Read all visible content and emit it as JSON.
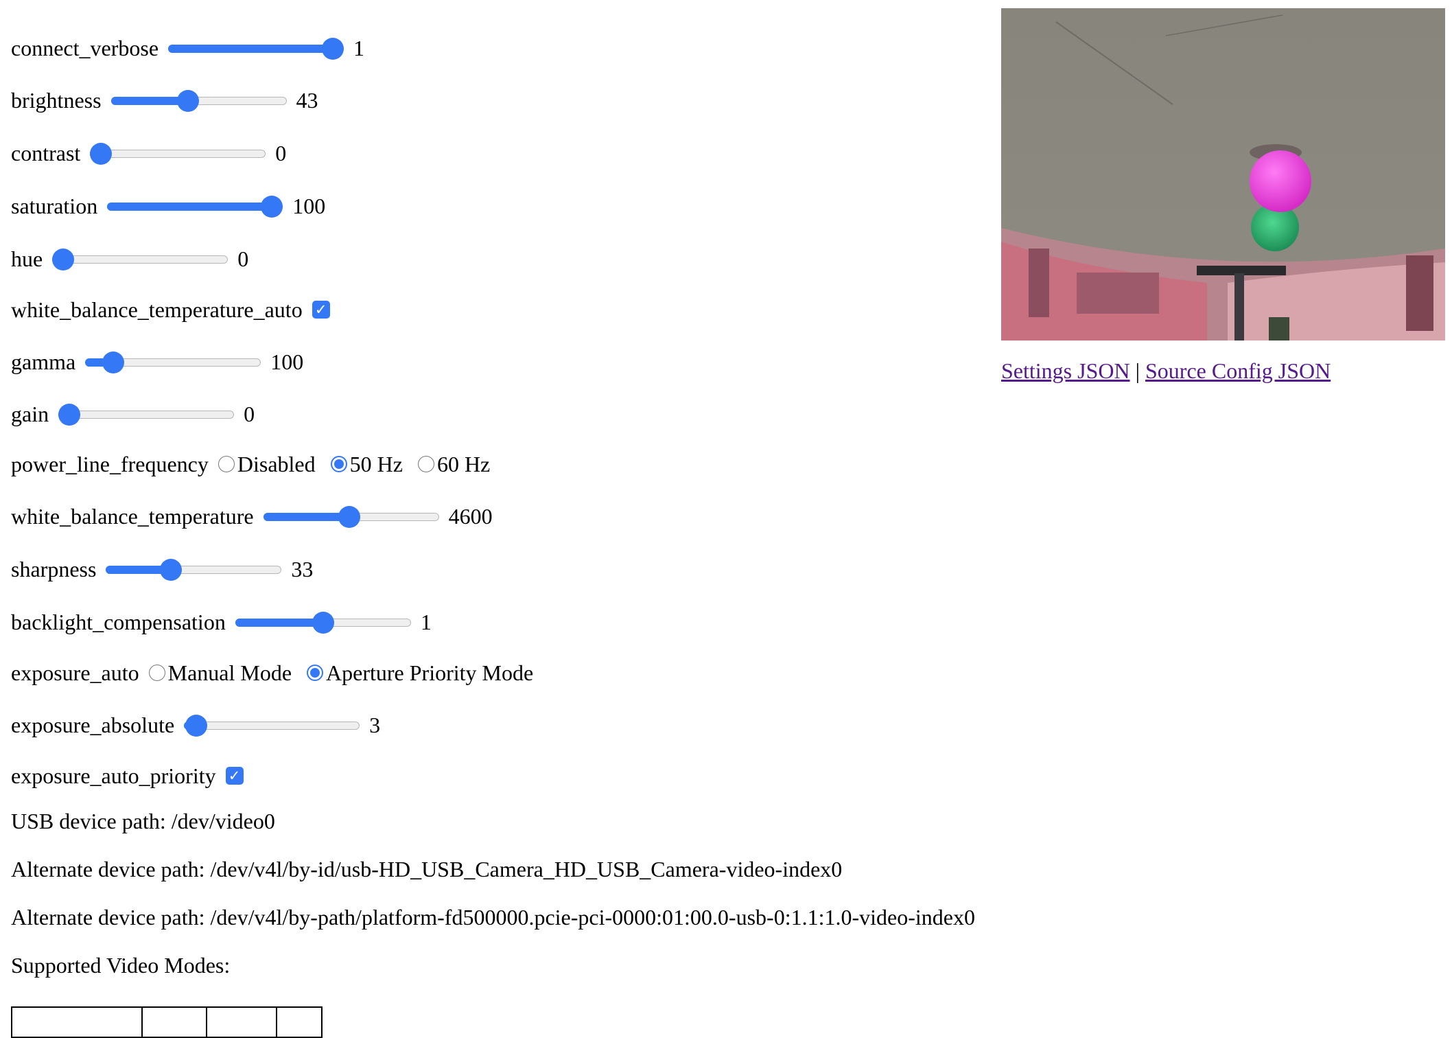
{
  "controls": {
    "connect_verbose": {
      "label": "connect_verbose",
      "value": "1",
      "fraction": 1.0
    },
    "brightness": {
      "label": "brightness",
      "value": "43",
      "fraction": 0.43
    },
    "contrast": {
      "label": "contrast",
      "value": "0",
      "fraction": 0.0
    },
    "saturation": {
      "label": "saturation",
      "value": "100",
      "fraction": 1.0
    },
    "hue": {
      "label": "hue",
      "value": "0",
      "fraction": 0.0
    },
    "white_balance_temperature_auto": {
      "label": "white_balance_temperature_auto",
      "checked": true
    },
    "gamma": {
      "label": "gamma",
      "value": "100",
      "fraction": 0.11
    },
    "gain": {
      "label": "gain",
      "value": "0",
      "fraction": 0.0
    },
    "power_line_frequency": {
      "label": "power_line_frequency",
      "options": [
        "Disabled",
        "50 Hz",
        "60 Hz"
      ],
      "selected": "50 Hz"
    },
    "white_balance_temperature": {
      "label": "white_balance_temperature",
      "value": "4600",
      "fraction": 0.49
    },
    "sharpness": {
      "label": "sharpness",
      "value": "33",
      "fraction": 0.35
    },
    "backlight_compensation": {
      "label": "backlight_compensation",
      "value": "1",
      "fraction": 0.5
    },
    "exposure_auto": {
      "label": "exposure_auto",
      "options": [
        "Manual Mode",
        "Aperture Priority Mode"
      ],
      "selected": "Aperture Priority Mode"
    },
    "exposure_absolute": {
      "label": "exposure_absolute",
      "value": "3",
      "fraction": 0.01
    },
    "exposure_auto_priority": {
      "label": "exposure_auto_priority",
      "checked": true
    }
  },
  "device": {
    "usb_path": "USB device path: /dev/video0",
    "alt_path_1": "Alternate device path: /dev/v4l/by-id/usb-HD_USB_Camera_HD_USB_Camera-video-index0",
    "alt_path_2": "Alternate device path: /dev/v4l/by-path/platform-fd500000.pcie-pci-0000:01:00.0-usb-0:1.1:1.0-video-index0",
    "modes_heading": "Supported Video Modes:"
  },
  "links": {
    "settings": "Settings JSON",
    "separator": "|",
    "source_config": "Source Config JSON"
  },
  "colors": {
    "accent": "#3478f6",
    "link_visited": "#551a8b"
  }
}
